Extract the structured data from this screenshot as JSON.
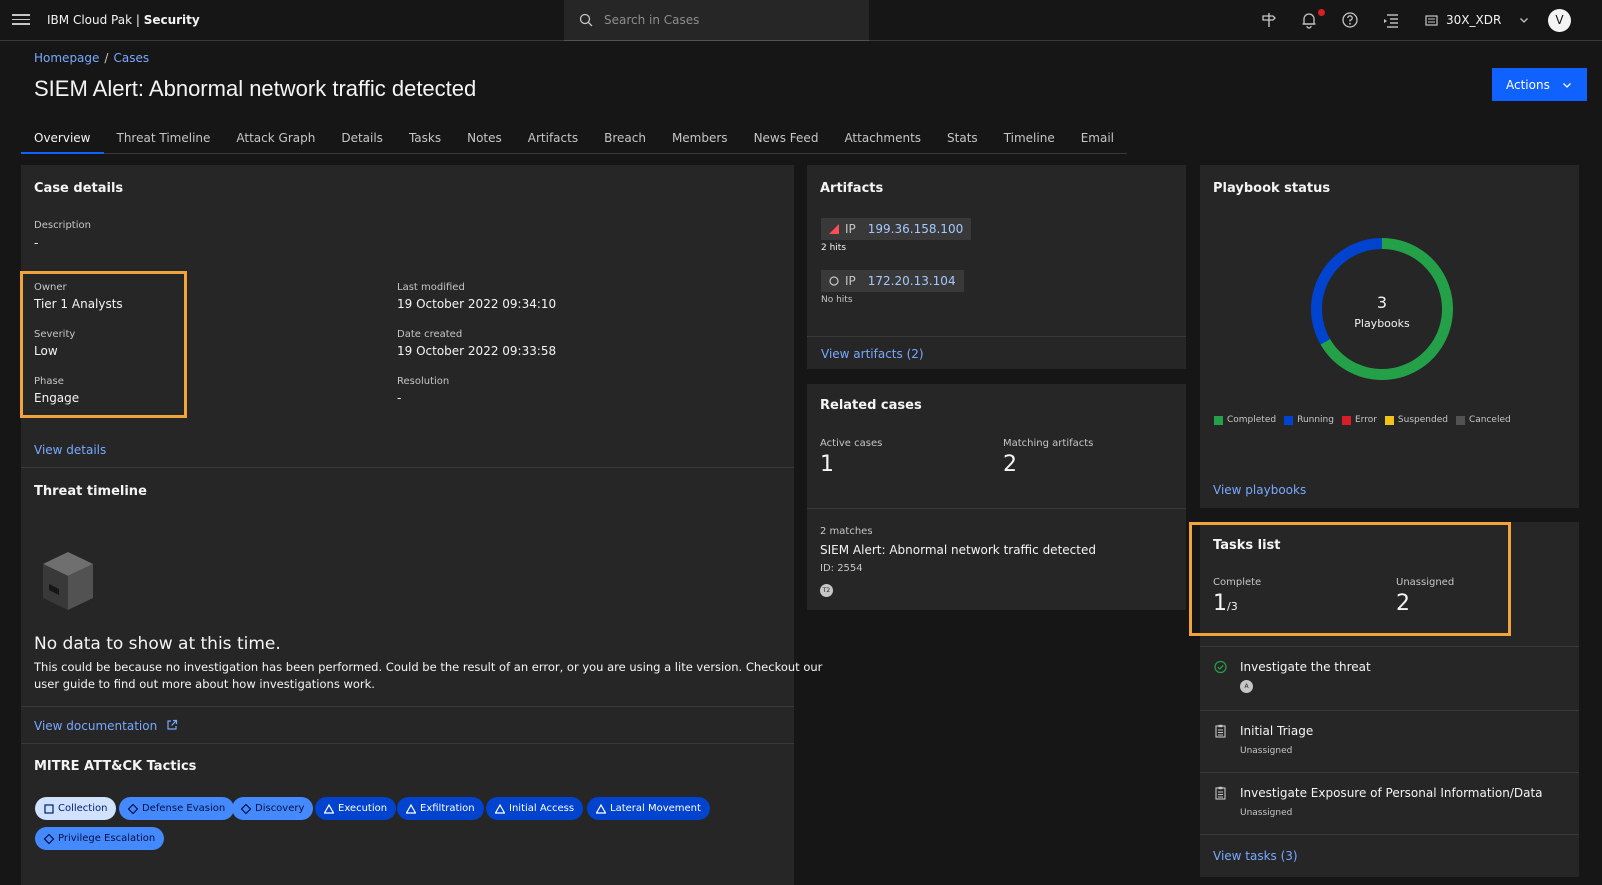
{
  "app": {
    "brand_prefix": "IBM Cloud Pak | ",
    "brand_product": "Security"
  },
  "search": {
    "placeholder": "Search in Cases",
    "value": ""
  },
  "tenant": {
    "name": "30X_XDR"
  },
  "user": {
    "avatar_initial": "V"
  },
  "breadcrumb": {
    "home": "Homepage",
    "sep": "/",
    "cases": "Cases"
  },
  "page": {
    "title": "SIEM Alert: Abnormal network traffic detected",
    "actions_label": "Actions"
  },
  "tabs": [
    {
      "label": "Overview"
    },
    {
      "label": "Threat Timeline"
    },
    {
      "label": "Attack Graph"
    },
    {
      "label": "Details"
    },
    {
      "label": "Tasks"
    },
    {
      "label": "Notes"
    },
    {
      "label": "Artifacts"
    },
    {
      "label": "Breach"
    },
    {
      "label": "Members"
    },
    {
      "label": "News Feed"
    },
    {
      "label": "Attachments"
    },
    {
      "label": "Stats"
    },
    {
      "label": "Timeline"
    },
    {
      "label": "Email"
    }
  ],
  "case_details": {
    "title": "Case details",
    "description_label": "Description",
    "description_value": "-",
    "owner_label": "Owner",
    "owner_value": "Tier 1 Analysts",
    "severity_label": "Severity",
    "severity_value": "Low",
    "phase_label": "Phase",
    "phase_value": "Engage",
    "last_modified_label": "Last modified",
    "last_modified_value": "19 October 2022 09:34:10",
    "date_created_label": "Date created",
    "date_created_value": "19 October 2022 09:33:58",
    "resolution_label": "Resolution",
    "resolution_value": "-",
    "view_details": "View details"
  },
  "threat_timeline": {
    "title": "Threat timeline",
    "empty_title": "No data to show at this time.",
    "empty_text_line1": "This could be because no investigation has been performed. Could be the result of an error, or you are using a lite version. Checkout our",
    "empty_text_line2": "user guide to find out more about how investigations work.",
    "view_documentation": "View documentation"
  },
  "mitre": {
    "title": "MITRE ATT&CK Tactics",
    "tags": [
      {
        "label": "Collection",
        "shape": "square",
        "style": "light"
      },
      {
        "label": "Defense Evasion",
        "shape": "diamond",
        "style": "mid"
      },
      {
        "label": "Discovery",
        "shape": "diamond",
        "style": "mid"
      },
      {
        "label": "Execution",
        "shape": "triangle",
        "style": "dark"
      },
      {
        "label": "Exfiltration",
        "shape": "triangle",
        "style": "dark"
      },
      {
        "label": "Initial Access",
        "shape": "triangle",
        "style": "dark"
      },
      {
        "label": "Lateral Movement",
        "shape": "triangle",
        "style": "dark"
      },
      {
        "label": "Privilege Escalation",
        "shape": "diamond",
        "style": "mid"
      }
    ]
  },
  "artifacts": {
    "title": "Artifacts",
    "items": [
      {
        "type": "IP",
        "value": "199.36.158.100",
        "hits": "2 hits"
      },
      {
        "type": "IP",
        "value": "172.20.13.104",
        "hits": "No hits"
      }
    ],
    "view_link": "View artifacts (2)"
  },
  "related_cases": {
    "title": "Related cases",
    "active_label": "Active cases",
    "active_value": "1",
    "matching_label": "Matching artifacts",
    "matching_value": "2",
    "matches_count": "2 matches",
    "match_title": "SIEM Alert: Abnormal network traffic detected",
    "match_id": "ID: 2554",
    "match_badge": "T2"
  },
  "playbook_status": {
    "title": "Playbook status",
    "center_value": "3",
    "center_label": "Playbooks",
    "legend": [
      {
        "label": "Completed",
        "color": "#24a148"
      },
      {
        "label": "Running",
        "color": "#0043ce"
      },
      {
        "label": "Error",
        "color": "#da1e28"
      },
      {
        "label": "Suspended",
        "color": "#f1c21b"
      },
      {
        "label": "Canceled",
        "color": "#525252"
      }
    ],
    "view_link": "View playbooks"
  },
  "chart_data": {
    "type": "pie",
    "categories": [
      "Completed",
      "Running"
    ],
    "values": [
      2,
      1
    ],
    "title": "Playbook status"
  },
  "tasks_list": {
    "title": "Tasks list",
    "complete_label": "Complete",
    "complete_value": "1",
    "complete_total": "/3",
    "unassigned_label": "Unassigned",
    "unassigned_value": "2",
    "items": [
      {
        "name": "Investigate the threat",
        "sub": "A",
        "status": "done"
      },
      {
        "name": "Initial Triage",
        "sub": "Unassigned",
        "status": "open"
      },
      {
        "name": "Investigate Exposure of Personal Information/Data",
        "sub": "Unassigned",
        "status": "open"
      }
    ],
    "view_link": "View tasks (3)"
  },
  "colors": {
    "accent": "#0f62fe",
    "highlight": "#f1a33c",
    "link": "#78a9ff",
    "success": "#24a148"
  }
}
